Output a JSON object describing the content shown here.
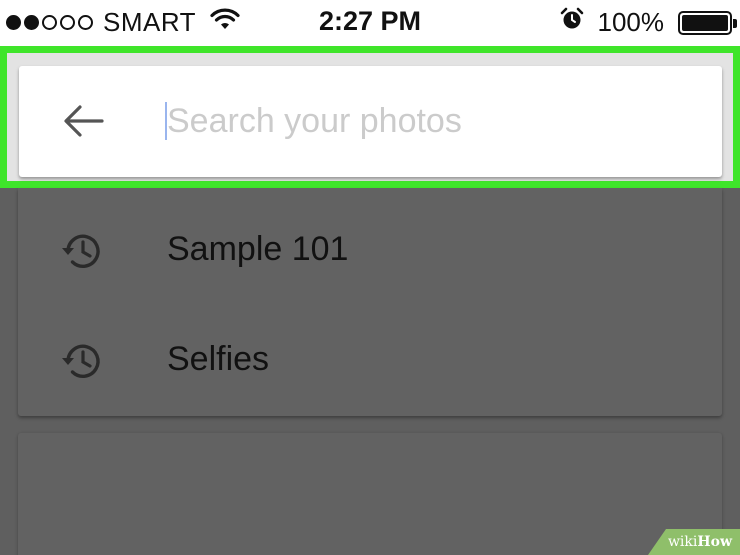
{
  "status_bar": {
    "signal_filled": 2,
    "signal_total": 5,
    "carrier": "SMART",
    "wifi_icon": "wifi-icon",
    "time": "2:27 PM",
    "alarm_icon": "alarm-clock-icon",
    "battery_percent": "100%",
    "battery_level": 1.0
  },
  "search": {
    "back_icon": "arrow-left-icon",
    "placeholder": "Search your photos",
    "value": ""
  },
  "recent_searches": [
    {
      "icon": "history-icon",
      "label": "Sample 101"
    },
    {
      "icon": "history-icon",
      "label": "Selfies"
    }
  ],
  "highlight": {
    "color": "#3fe52a"
  },
  "watermark": {
    "prefix": "wiki",
    "suffix": "How"
  }
}
